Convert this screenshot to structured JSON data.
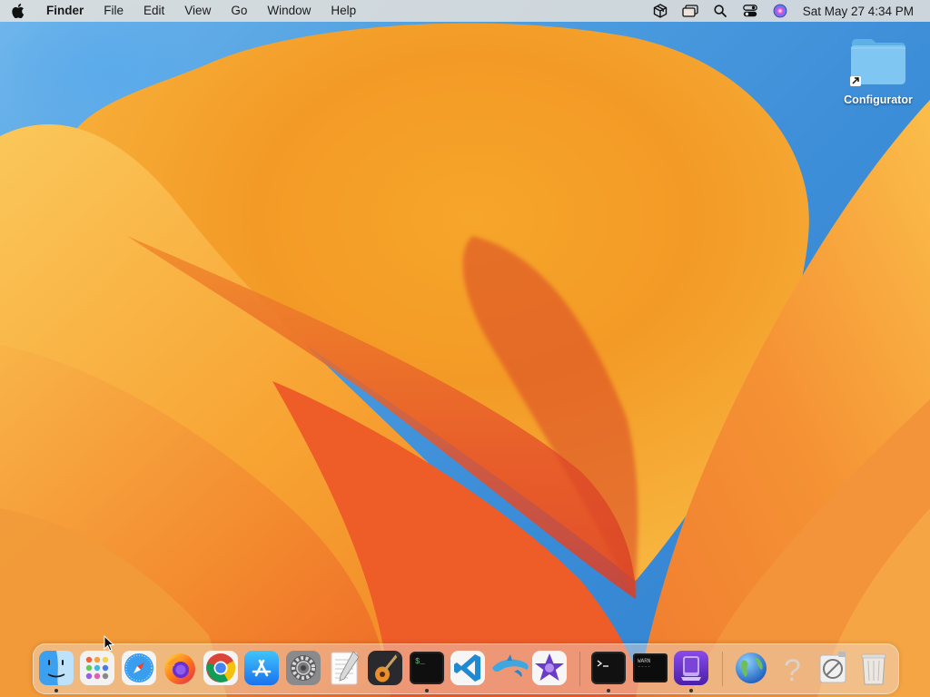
{
  "menubar": {
    "app_name": "Finder",
    "menus": [
      "File",
      "Edit",
      "View",
      "Go",
      "Window",
      "Help"
    ],
    "clock": "Sat May 27  4:34 PM",
    "status_icons": [
      "package-icon",
      "window-stack-icon",
      "search-icon",
      "control-center-icon",
      "siri-icon"
    ]
  },
  "desktop": {
    "folder_label": "Configurator"
  },
  "dock": {
    "apps": [
      "Finder",
      "Launchpad",
      "Safari",
      "Firefox",
      "Google Chrome",
      "App Store",
      "System Preferences",
      "TextEdit",
      "GarageBand",
      "Terminal",
      "Visual Studio Code",
      "Dolphin",
      "iMovie",
      "Terminal",
      "Console",
      "Apple Configurator",
      "Network Utility",
      "Help Viewer",
      "Screenshot",
      "Trash"
    ],
    "running": [
      "Finder",
      "Terminal",
      "Terminal",
      "Apple Configurator"
    ]
  }
}
